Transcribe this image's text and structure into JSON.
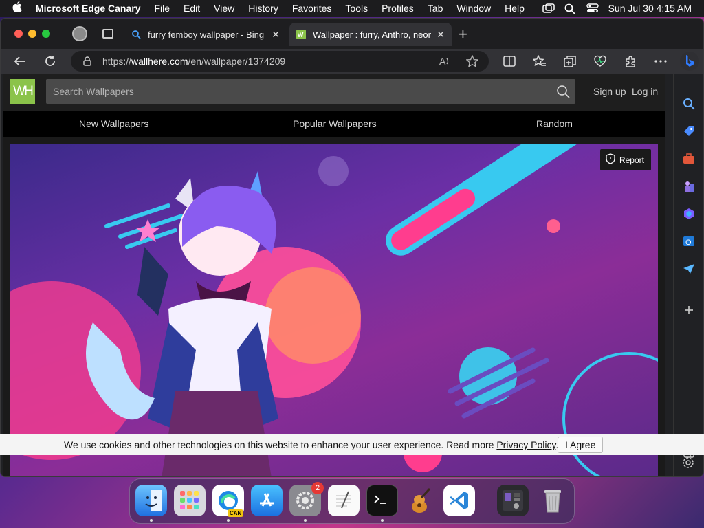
{
  "menubar": {
    "app_name": "Microsoft Edge Canary",
    "menus": [
      "File",
      "Edit",
      "View",
      "History",
      "Favorites",
      "Tools",
      "Profiles",
      "Tab",
      "Window",
      "Help"
    ],
    "datetime": "Sun Jul 30  4:15 AM"
  },
  "tabs": [
    {
      "title": "furry femboy wallpaper - Bing",
      "active": false
    },
    {
      "title": "Wallpaper : furry, Anthro, neon",
      "active": true
    }
  ],
  "toolbar": {
    "url_prefix": "https://",
    "url_host": "wallhere.com",
    "url_path": "/en/wallpaper/1374209"
  },
  "site": {
    "logo_text": "WH",
    "search_placeholder": "Search Wallpapers",
    "sign_up": "Sign up",
    "log_in": "Log in",
    "nav": [
      "New Wallpapers",
      "Popular Wallpapers",
      "Random"
    ],
    "report_label": "Report"
  },
  "cookie": {
    "message": "We use cookies and other technologies on this website to enhance your user experience. Read more ",
    "policy_link": "Privacy Policy",
    "agree": "I Agree"
  },
  "dock": {
    "settings_badge": "2",
    "edge_label": "CAN"
  },
  "colors": {
    "accent_logo": "#8bc34a",
    "page_bg": "#1a1a1a",
    "nav_bg": "#000000"
  }
}
